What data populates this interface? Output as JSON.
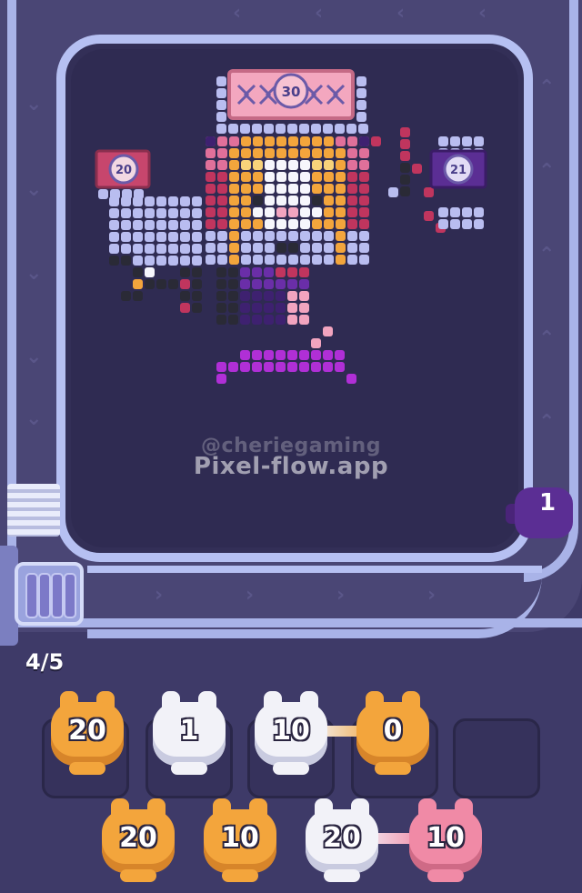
{
  "board": {
    "main_target": "30",
    "left_target": "20",
    "right_target": "21",
    "shooter_count": "1"
  },
  "watermark": {
    "handle": "@cheriegaming",
    "site": "Pixel-flow.app"
  },
  "queue": {
    "counter": "4/5",
    "slots": [
      {
        "color": "orange",
        "value": "20"
      },
      {
        "color": "white",
        "value": "1"
      },
      {
        "color": "white",
        "value": "10",
        "linked": true
      },
      {
        "color": "orange",
        "value": "0",
        "linked": true
      },
      {
        "color": "empty",
        "value": ""
      }
    ]
  },
  "reserve": [
    {
      "color": "orange",
      "value": "20"
    },
    {
      "color": "orange",
      "value": "10"
    },
    {
      "color": "white",
      "value": "20",
      "linked": true
    },
    {
      "color": "pink",
      "value": "10",
      "linked": true
    }
  ],
  "colors": {
    "background": "#3e3a68",
    "belt": "#a9b3e8",
    "orange": "#f3a53c",
    "white": "#f2f2f8",
    "pink": "#f08aa6",
    "purple": "#5b2e94"
  }
}
